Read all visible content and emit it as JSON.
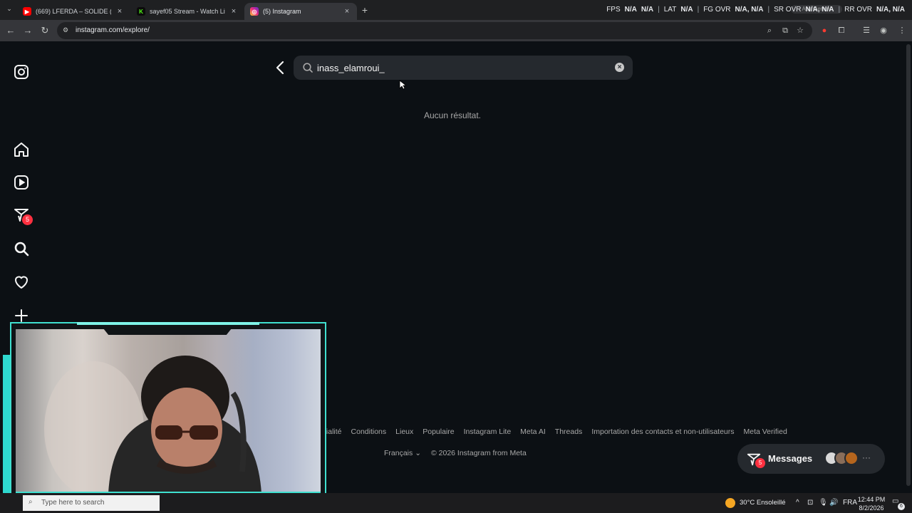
{
  "browser": {
    "tabs": [
      {
        "title": "(669) LFERDA – SOLIDE (Official",
        "favicon": "youtube",
        "color": "#ff0000"
      },
      {
        "title": "sayef05 Stream - Watch Live on",
        "favicon": "kick",
        "color": "#53fc18"
      },
      {
        "title": "(5) Instagram",
        "favicon": "instagram",
        "color": "#e1306c",
        "active": true
      }
    ],
    "new_tab": "+",
    "url": "instagram.com/explore/",
    "gemini_label": "Ask Gemini"
  },
  "overlay_stats": [
    {
      "label": "FPS",
      "value": "N/A"
    },
    {
      "label": "",
      "value": "N/A"
    },
    {
      "label": "LAT",
      "value": "N/A"
    },
    {
      "label": "FG OVR",
      "value": "N/A, N/A"
    },
    {
      "label": "SR OVR",
      "value": "N/A, N/A"
    },
    {
      "label": "RR OVR",
      "value": "N/A, N/A"
    }
  ],
  "sidebar": {
    "notification_count": "5"
  },
  "search": {
    "query": "inass_elamroui_",
    "clear_icon": "×",
    "no_results": "Aucun résultat."
  },
  "footer": {
    "links": [
      "tialité",
      "Conditions",
      "Lieux",
      "Populaire",
      "Instagram Lite",
      "Meta AI",
      "Threads",
      "Importation des contacts et non-utilisateurs",
      "Meta Verified"
    ],
    "language": "Français",
    "copyright": "© 2026 Instagram from Meta"
  },
  "messages": {
    "label": "Messages",
    "badge": "5",
    "more": "···"
  },
  "taskbar": {
    "search_placeholder": "Type here to search",
    "weather": "30°C  Ensoleillé",
    "language": "FRA",
    "time": "12:44 PM",
    "date": "8/2/2026",
    "notification_count": "6"
  }
}
